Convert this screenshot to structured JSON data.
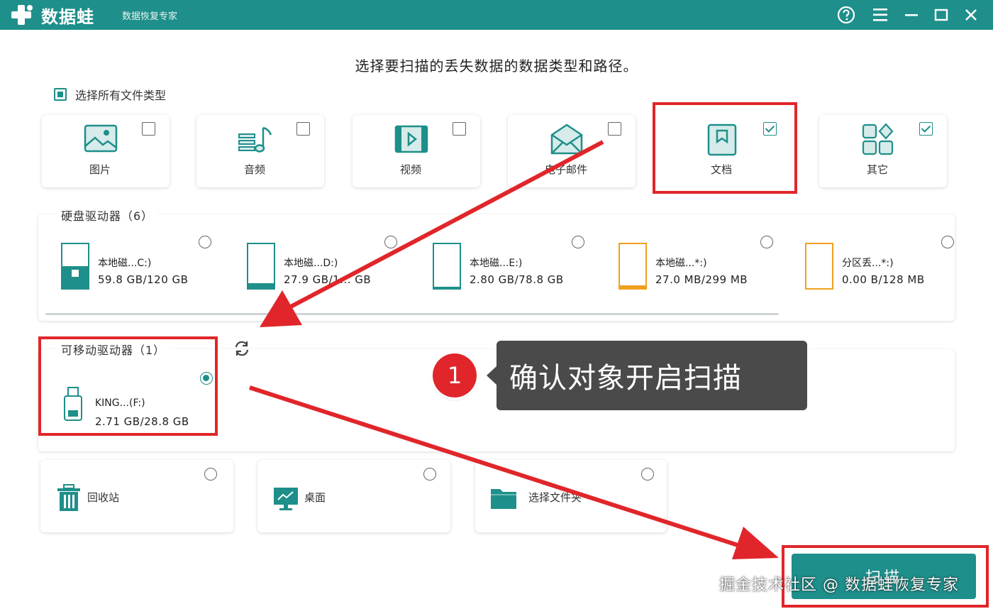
{
  "app": {
    "name": "数据蛙",
    "subtitle": "数据恢复专家"
  },
  "header": {
    "main_title": "选择要扫描的丢失数据的数据类型和路径。",
    "select_all_label": "选择所有文件类型"
  },
  "file_types": [
    {
      "label": "图片",
      "icon": "image-icon",
      "checked": false
    },
    {
      "label": "音频",
      "icon": "music-icon",
      "checked": false
    },
    {
      "label": "视频",
      "icon": "video-icon",
      "checked": false
    },
    {
      "label": "电子邮件",
      "icon": "mail-icon",
      "checked": false
    },
    {
      "label": "文档",
      "icon": "document-icon",
      "checked": true
    },
    {
      "label": "其它",
      "icon": "other-icon",
      "checked": true
    }
  ],
  "hard_drives": {
    "label": "硬盘驱动器（6）",
    "items": [
      {
        "name": "本地磁...C:)",
        "size": "59.8 GB/120 GB",
        "usage": 0.5
      },
      {
        "name": "本地磁...D:)",
        "size": "27.9 GB/1... GB",
        "usage": 0.23
      },
      {
        "name": "本地磁...E:)",
        "size": "2.80 GB/78.8 GB",
        "usage": 0.04
      },
      {
        "name": "本地磁...*:)",
        "size": "27.0 MB/299 MB",
        "usage": 0.09
      },
      {
        "name": "分区丢...*:)",
        "size": "0.00  B/128 MB",
        "usage": 0
      }
    ]
  },
  "removable": {
    "label": "可移动驱动器（1）",
    "items": [
      {
        "name": "KING...(F:)",
        "size": "2.71 GB/28.8 GB",
        "selected": true
      }
    ]
  },
  "locations": [
    {
      "label": "回收站",
      "icon": "recycle-bin-icon"
    },
    {
      "label": "桌面",
      "icon": "desktop-icon"
    },
    {
      "label": "选择文件夹",
      "icon": "folder-icon"
    }
  ],
  "scan_button": "扫描",
  "annotation": {
    "step": "1",
    "text": "确认对象开启扫描"
  },
  "watermark": "掘金技术社区 @ 数据蛙恢复专家",
  "colors": {
    "accent": "#1e8f8a",
    "highlight": "#e0262a",
    "drive_orange": "#f0a020"
  }
}
